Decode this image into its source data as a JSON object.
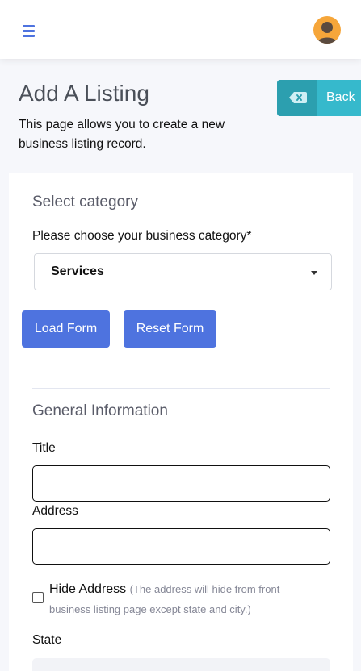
{
  "header": {
    "menu_icon": "hamburger-menu-icon",
    "avatar_icon": "user-avatar-icon",
    "avatar_color": "#f6a63a"
  },
  "page": {
    "title": "Add A Listing",
    "description": "This page allows you to create a new business listing record."
  },
  "back_button": {
    "label": "Back",
    "icon": "backspace-icon",
    "color": "#36b9cc"
  },
  "category_section": {
    "title": "Select category",
    "prompt": "Please choose your business category*",
    "selected_category": "Services",
    "load_button": "Load Form",
    "reset_button": "Reset Form"
  },
  "general_section": {
    "title": "General Information",
    "title_label": "Title",
    "title_value": "",
    "address_label": "Address",
    "address_value": "",
    "hide_address_label": "Hide Address",
    "hide_address_hint": "(The address will hide from front business listing page except state and city.)",
    "hide_address_checked": false,
    "state_label": "State"
  },
  "colors": {
    "primary": "#4e73df",
    "info": "#36b9cc",
    "page_bg": "#f6f7fb"
  }
}
